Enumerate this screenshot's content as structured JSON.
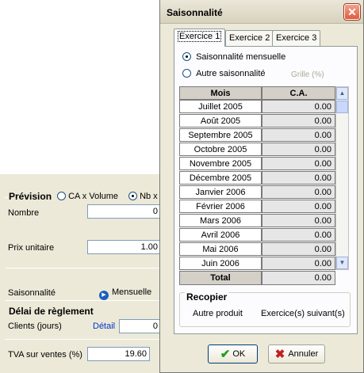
{
  "background": {
    "prevision": {
      "title": "Prévision",
      "options": [
        "CA x Volume",
        "Nb x"
      ],
      "selected": 1,
      "nombre_label": "Nombre",
      "nombre_value": "0",
      "prix_label": "Prix unitaire",
      "prix_value": "1.00"
    },
    "saisonnalite_label": "Saisonnalité",
    "saisonnalite_link": "Mensuelle",
    "delai": {
      "title": "Délai de règlement",
      "clients_label": "Clients (jours)",
      "detail_link": "Détail",
      "clients_value": "0"
    },
    "tva_label": "TVA sur ventes (%)",
    "tva_value": "19.60"
  },
  "dialog": {
    "title": "Saisonnalité",
    "close_glyph": "✕",
    "tabs": [
      "Exercice 1",
      "Exercice 2",
      "Exercice 3"
    ],
    "active_tab": 0,
    "option_mensuelle": "Saisonnalité mensuelle",
    "option_autre": "Autre saisonnalité",
    "grille_label": "Grille (%)",
    "grid": {
      "headers": [
        "Mois",
        "C.A."
      ],
      "rows": [
        {
          "mois": "Juillet 2005",
          "ca": "0.00"
        },
        {
          "mois": "Août 2005",
          "ca": "0.00"
        },
        {
          "mois": "Septembre 2005",
          "ca": "0.00"
        },
        {
          "mois": "Octobre 2005",
          "ca": "0.00"
        },
        {
          "mois": "Novembre 2005",
          "ca": "0.00"
        },
        {
          "mois": "Décembre 2005",
          "ca": "0.00"
        },
        {
          "mois": "Janvier 2006",
          "ca": "0.00"
        },
        {
          "mois": "Février 2006",
          "ca": "0.00"
        },
        {
          "mois": "Mars 2006",
          "ca": "0.00"
        },
        {
          "mois": "Avril 2006",
          "ca": "0.00"
        },
        {
          "mois": "Mai 2006",
          "ca": "0.00"
        },
        {
          "mois": "Juin 2006",
          "ca": "0.00"
        }
      ],
      "total_label": "Total",
      "total_value": "0.00"
    },
    "recopier": {
      "title": "Recopier",
      "autre_produit": "Autre produit",
      "exercices_suivants": "Exercice(s) suivant(s)"
    },
    "ok_label": "OK",
    "cancel_label": "Annuler"
  }
}
